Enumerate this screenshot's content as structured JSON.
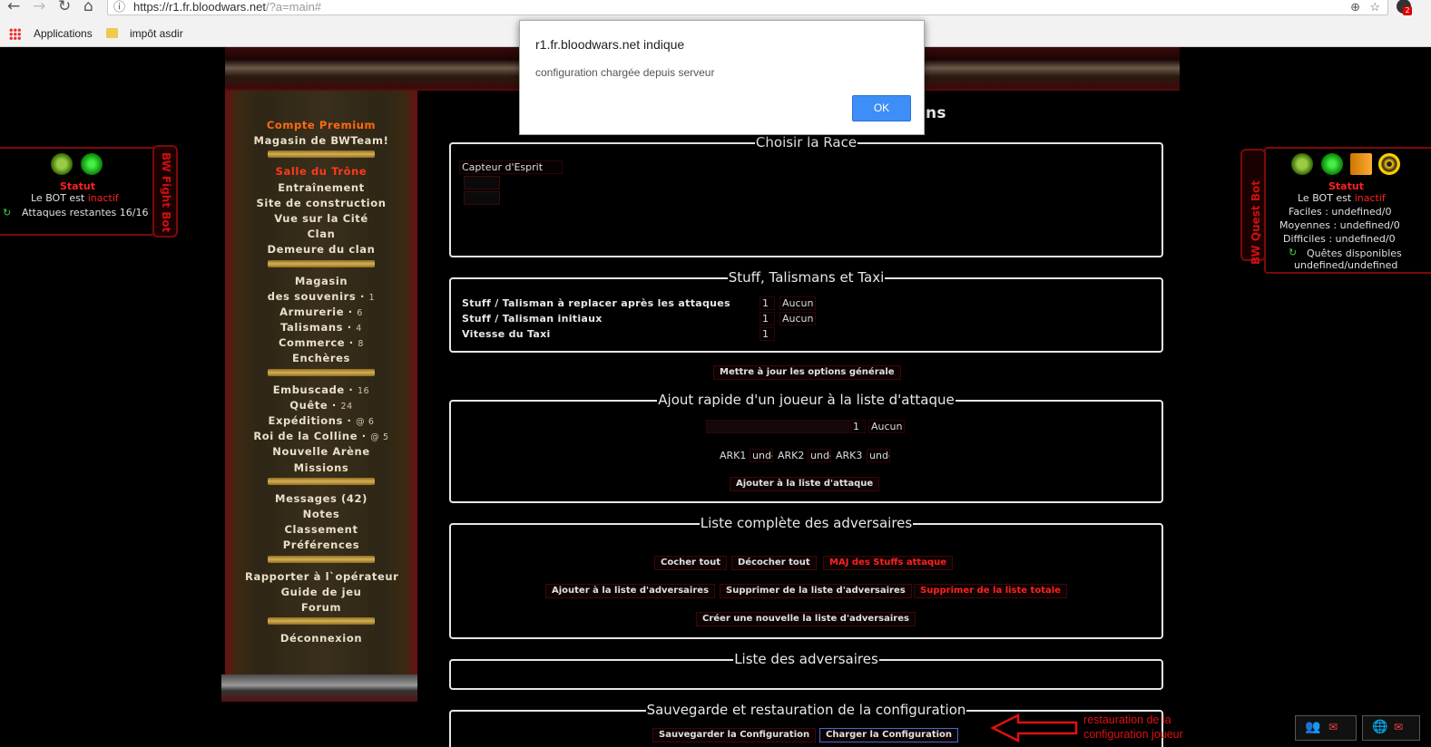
{
  "browser": {
    "url_host": "https://r1.fr.bloodwars.net",
    "url_path": "/?a=main#",
    "bookmarks": [
      "Applications",
      "impôt asdir"
    ],
    "ext_badge": "2"
  },
  "dialog": {
    "title": "r1.fr.bloodwars.net indique",
    "message": "configuration chargée depuis serveur",
    "ok_label": "OK"
  },
  "menu": {
    "groups": [
      [
        {
          "label": "Compte Premium",
          "style": "orange"
        },
        {
          "label": "Magasin de BWTeam!"
        }
      ],
      [
        {
          "label": "Salle du Trône",
          "style": "red"
        },
        {
          "label": "Entraînement"
        },
        {
          "label": "Site de construction"
        },
        {
          "label": "Vue sur la Cité"
        },
        {
          "label": "Clan"
        },
        {
          "label": "Demeure du clan"
        }
      ],
      [
        {
          "label": "Magasin"
        },
        {
          "label": "des souvenirs",
          "num": "1"
        },
        {
          "label": "Armurerie",
          "num": "6"
        },
        {
          "label": "Talismans",
          "num": "4"
        },
        {
          "label": "Commerce",
          "num": "8"
        },
        {
          "label": "Enchères"
        }
      ],
      [
        {
          "label": "Embuscade",
          "num": "16"
        },
        {
          "label": "Quête",
          "num": "24"
        },
        {
          "label": "Expéditions",
          "num": "@ 6"
        },
        {
          "label": "Roi de la Colline",
          "num": "@ 5"
        },
        {
          "label": "Nouvelle Arène"
        },
        {
          "label": "Missions"
        }
      ],
      [
        {
          "label": "Messages (42)"
        },
        {
          "label": "Notes"
        },
        {
          "label": "Classement"
        },
        {
          "label": "Préférences"
        }
      ],
      [
        {
          "label": "Rapporter à l`opérateur"
        },
        {
          "label": "Guide de jeu"
        },
        {
          "label": "Forum"
        }
      ],
      [
        {
          "label": "Déconnexion"
        }
      ]
    ]
  },
  "page_title_tail": "ns",
  "race": {
    "legend": "Choisir la Race",
    "selected": "Capteur d'Esprit"
  },
  "stuff": {
    "legend": "Stuff, Talismans et Taxi",
    "rows": [
      {
        "label": "Stuff / Talisman à replacer après les attaques",
        "num": "1",
        "value": "Aucun"
      },
      {
        "label": "Stuff / Talisman initiaux",
        "num": "1",
        "value": "Aucun"
      },
      {
        "label": "Vitesse du Taxi",
        "num": "1",
        "value": ""
      }
    ],
    "update_btn": "Mettre à jour les options générale"
  },
  "quick_add": {
    "legend": "Ajout rapide d'un joueur à la liste d'attaque",
    "num": "1",
    "value": "Aucun",
    "ark": [
      {
        "label": "ARK1",
        "value": "undefined"
      },
      {
        "label": "ARK2",
        "value": "undefined"
      },
      {
        "label": "ARK3",
        "value": "undefined"
      }
    ],
    "add_btn": "Ajouter à la liste d'attaque"
  },
  "full_list": {
    "legend": "Liste complète des adversaires",
    "buttons_row1": [
      "Cocher tout",
      "Décocher tout",
      "MAJ des Stuffs attaque"
    ],
    "buttons_row2": [
      "Ajouter à la liste d'adversaires",
      "Supprimer de la liste d'adversaires",
      "Supprimer de la liste totale"
    ],
    "create_btn": "Créer une nouvelle la liste d'adversaires"
  },
  "adv_list": {
    "legend": "Liste des adversaires"
  },
  "save": {
    "legend": "Sauvegarde et restauration de la configuration",
    "save_btn": "Sauvegarder la Configuration",
    "load_btn": "Charger la Configuration"
  },
  "annotation": {
    "line1": "restauration de la",
    "line2": "configuration joueur"
  },
  "fight_bot": {
    "tab_label": "BW Fight Bot",
    "status_title": "Statut",
    "status_prefix": "Le BOT est ",
    "status_value": "inactif",
    "attacks": "Attaques restantes 16/16"
  },
  "quest_bot": {
    "tab_label": "BW Quest Bot",
    "status_title": "Statut",
    "status_prefix": "Le BOT est ",
    "status_value": "inactif",
    "lines": [
      "Faciles : undefined/0",
      "Moyennes : undefined/0",
      "Difficiles : undefined/0"
    ],
    "available_label": "Quêtes disponibles",
    "available_value": "undefined/undefined"
  },
  "colors": {
    "accent_red": "#ff2020",
    "dialog_button": "#3e8ef7",
    "menu_text": "#e8e0c8"
  }
}
